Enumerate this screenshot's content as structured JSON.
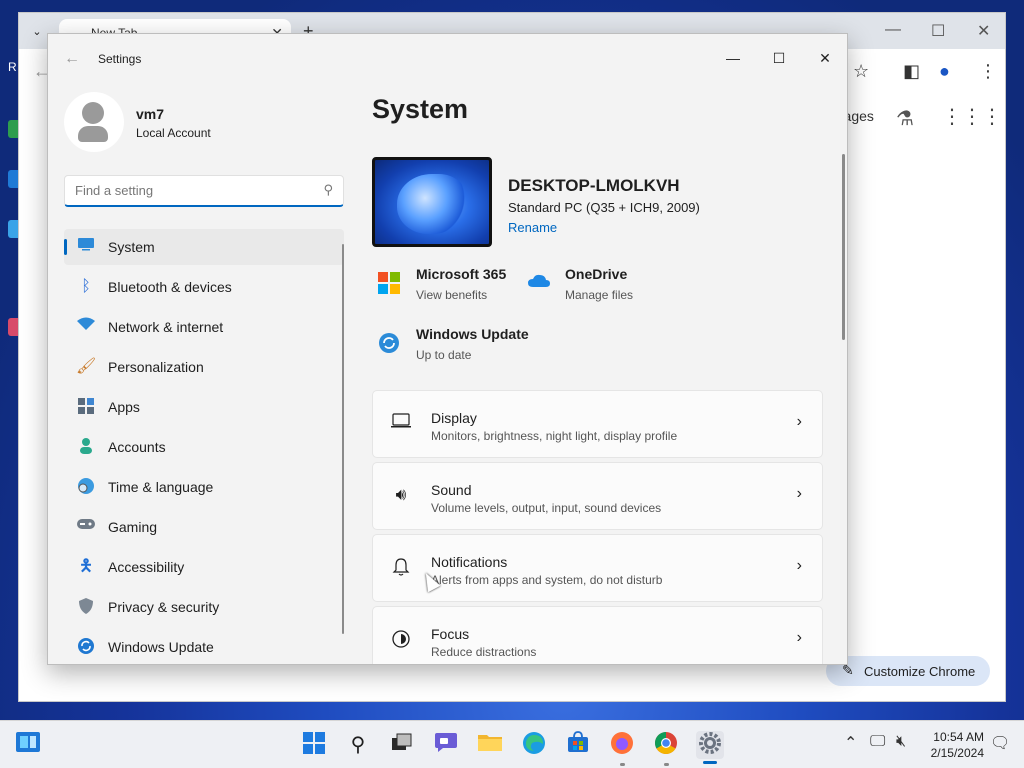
{
  "chrome": {
    "tab_title": "New Tab",
    "images_link": "Images",
    "customize_button": "Customize Chrome",
    "partial_letter": "R"
  },
  "settings": {
    "app_title": "Settings",
    "profile": {
      "name": "vm7",
      "account_type": "Local Account"
    },
    "search": {
      "placeholder": "Find a setting"
    },
    "nav": [
      {
        "label": "System",
        "icon": "monitor-icon",
        "selected": true
      },
      {
        "label": "Bluetooth & devices",
        "icon": "bluetooth-icon"
      },
      {
        "label": "Network & internet",
        "icon": "wifi-icon"
      },
      {
        "label": "Personalization",
        "icon": "brush-icon"
      },
      {
        "label": "Apps",
        "icon": "apps-icon"
      },
      {
        "label": "Accounts",
        "icon": "accounts-icon"
      },
      {
        "label": "Time & language",
        "icon": "globe-clock-icon"
      },
      {
        "label": "Gaming",
        "icon": "gamepad-icon"
      },
      {
        "label": "Accessibility",
        "icon": "accessibility-icon"
      },
      {
        "label": "Privacy & security",
        "icon": "shield-icon"
      },
      {
        "label": "Windows Update",
        "icon": "update-icon"
      }
    ],
    "page_title": "System",
    "device": {
      "name": "DESKTOP-LMOLKVH",
      "spec": "Standard PC (Q35 + ICH9, 2009)",
      "rename": "Rename"
    },
    "tiles": {
      "m365": {
        "title": "Microsoft 365",
        "sub": "View benefits"
      },
      "onedrive": {
        "title": "OneDrive",
        "sub": "Manage files"
      },
      "update": {
        "title": "Windows Update",
        "sub": "Up to date"
      }
    },
    "cards": [
      {
        "title": "Display",
        "sub": "Monitors, brightness, night light, display profile",
        "icon": "laptop-icon"
      },
      {
        "title": "Sound",
        "sub": "Volume levels, output, input, sound devices",
        "icon": "speaker-icon"
      },
      {
        "title": "Notifications",
        "sub": "Alerts from apps and system, do not disturb",
        "icon": "bell-icon"
      },
      {
        "title": "Focus",
        "sub": "Reduce distractions",
        "icon": "focus-icon"
      }
    ]
  },
  "taskbar": {
    "time": "10:54 AM",
    "date": "2/15/2024"
  },
  "colors": {
    "accent": "#0067c0",
    "settings_bg": "#f3f3f3",
    "taskbar_bg": "#eef0f4"
  }
}
